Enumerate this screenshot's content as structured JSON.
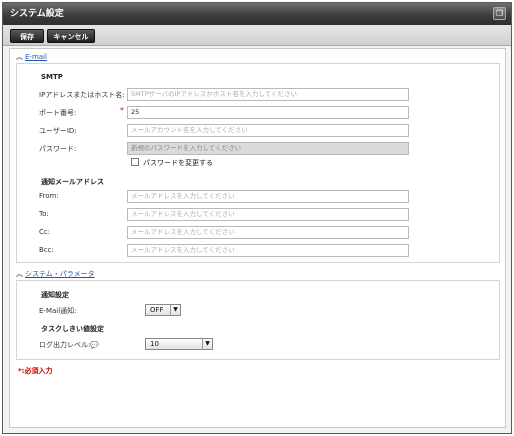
{
  "window": {
    "title": "システム設定",
    "title_button_icon": "restore-icon"
  },
  "toolbar": {
    "save_label": "保存",
    "cancel_label": "キャンセル"
  },
  "email_section": {
    "header": "E-mail",
    "smtp": {
      "title": "SMTP",
      "host_label": "IPアドレスまたはホスト名:",
      "host_placeholder": "SMTPサーバのIPアドレスかホスト名を入力してください",
      "port_label": "ポート番号:",
      "port_value": "25",
      "required_mark": "*",
      "user_label": "ユーザーID:",
      "user_placeholder": "メールアカウント名を入力してください",
      "password_label": "パスワード:",
      "password_placeholder": "新規のパスワードを入力してください",
      "change_password_label": "パスワードを変更する"
    },
    "addresses": {
      "title": "通知メールアドレス",
      "from_label": "From:",
      "to_label": "To:",
      "cc_label": "Cc:",
      "bcc_label": "Bcc:",
      "placeholder": "メールアドレスを入力してください"
    }
  },
  "system_section": {
    "header": "システム・パラメータ",
    "notification": {
      "title": "通知設定",
      "email_label": "E-Mail通知:",
      "email_value": "OFF"
    },
    "threshold": {
      "title": "タスクしきい値設定",
      "log_level_label": "ログ出力レベル:",
      "log_level_value": "10"
    }
  },
  "footer": {
    "required_note": "*:必須入力"
  }
}
